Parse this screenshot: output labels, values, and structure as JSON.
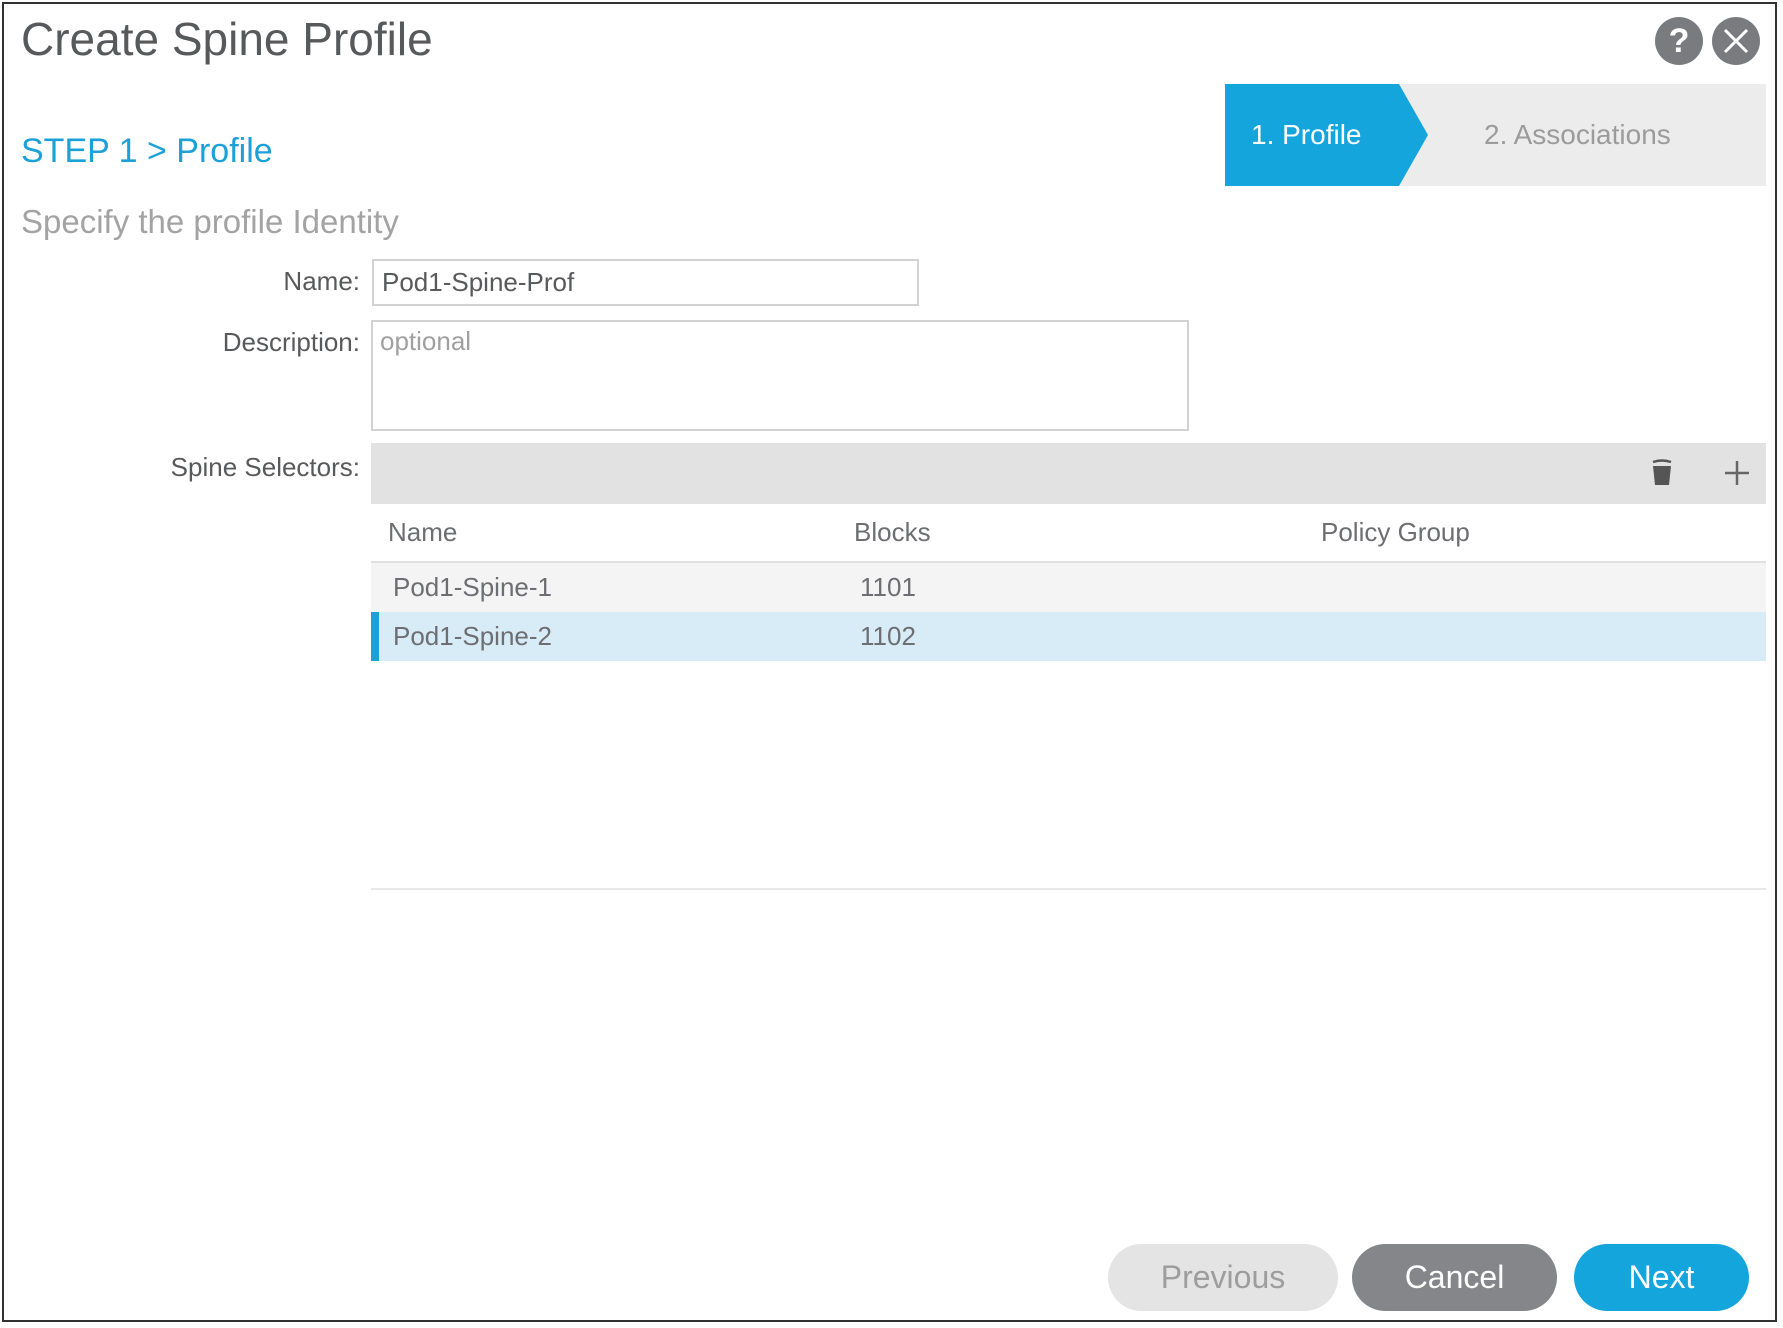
{
  "dialog": {
    "title": "Create Spine Profile",
    "help_icon": "question-mark-icon",
    "close_icon": "close-x-icon"
  },
  "wizard": {
    "breadcrumb": "STEP 1 > Profile",
    "steps": [
      {
        "label": "1. Profile",
        "active": true
      },
      {
        "label": "2. Associations",
        "active": false
      }
    ],
    "accent_color": "#14a5dc"
  },
  "form": {
    "subtitle": "Specify the profile Identity",
    "name_label": "Name:",
    "name_value": "Pod1-Spine-Prof",
    "description_label": "Description:",
    "description_value": "",
    "description_placeholder": "optional",
    "selectors_label": "Spine Selectors:"
  },
  "selectors_table": {
    "toolbar": {
      "delete_icon": "trash-icon",
      "add_icon": "plus-icon"
    },
    "columns": [
      "Name",
      "Blocks",
      "Policy Group"
    ],
    "rows": [
      {
        "name": "Pod1-Spine-1",
        "blocks": "1101",
        "policy_group": "",
        "selected": false
      },
      {
        "name": "Pod1-Spine-2",
        "blocks": "1102",
        "policy_group": "",
        "selected": true
      }
    ]
  },
  "footer": {
    "previous_label": "Previous",
    "cancel_label": "Cancel",
    "next_label": "Next"
  }
}
